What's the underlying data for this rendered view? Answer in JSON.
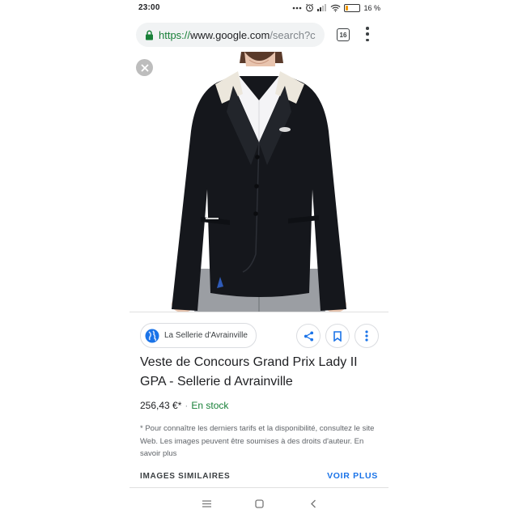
{
  "status_bar": {
    "time": "23:00",
    "battery_percent": "16 %",
    "battery_level": 0.16,
    "icons": [
      "more-dots-icon",
      "alarm-icon",
      "signal-icon",
      "wifi-icon",
      "battery-icon"
    ]
  },
  "browser": {
    "url_scheme": "https://",
    "url_host": "www.google.com",
    "url_path": "/search?c",
    "tab_count": "16"
  },
  "product": {
    "source_name": "La Sellerie d'Avrainville",
    "title": "Veste de Concours Grand Prix Lady II GPA - Sellerie d Avrainville",
    "price": "256,43 €*",
    "separator": "·",
    "stock": "En stock",
    "disclaimer": "* Pour connaître les derniers tarifs et la disponibilité, consultez le site Web. Les images peuvent être soumises à des droits d'auteur. En savoir plus"
  },
  "similar": {
    "label": "IMAGES SIMILAIRES",
    "see_more": "VOIR PLUS"
  },
  "colors": {
    "link_blue": "#1a73e8",
    "stock_green": "#188038",
    "jacket_black": "#15171c",
    "battery_orange": "#f29900"
  }
}
